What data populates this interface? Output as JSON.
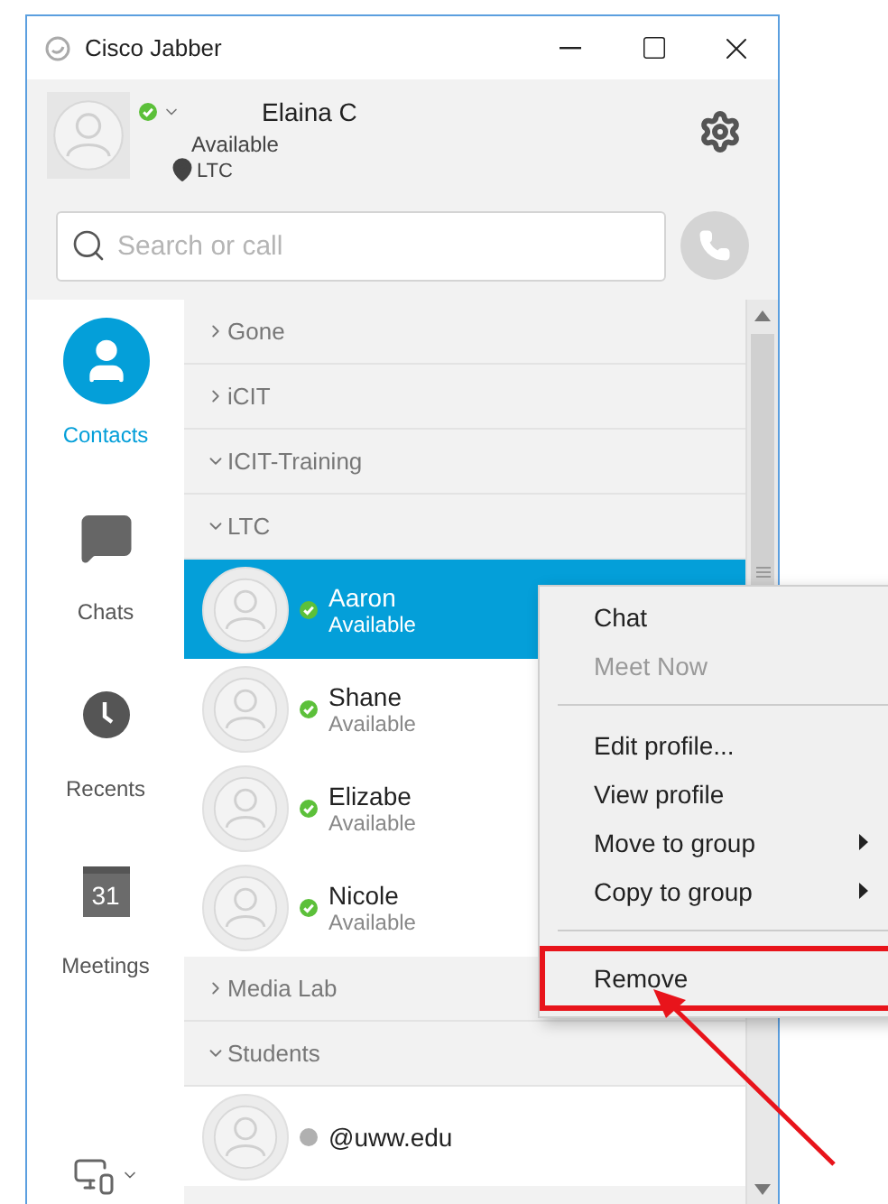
{
  "window": {
    "title": "Cisco Jabber"
  },
  "profile": {
    "name": "Elaina C",
    "online": true,
    "status_text": "Available",
    "location": "LTC"
  },
  "search": {
    "placeholder": "Search or call"
  },
  "nav": [
    {
      "kind": "contacts",
      "label": "Contacts",
      "selected": true
    },
    {
      "kind": "chats",
      "label": "Chats",
      "selected": false
    },
    {
      "kind": "recents",
      "label": "Recents",
      "selected": false
    },
    {
      "kind": "meetings",
      "label": "Meetings",
      "selected": false,
      "badge": "31"
    }
  ],
  "groups": [
    {
      "label": "Gone",
      "expanded": false
    },
    {
      "label": "iCIT",
      "expanded": false
    },
    {
      "label": "ICIT-Training",
      "expanded": true
    },
    {
      "label": "LTC",
      "expanded": true,
      "contacts": [
        {
          "name": "Aaron",
          "online": true,
          "status_text": "Available",
          "selected": true
        },
        {
          "name": "Shane",
          "online": true,
          "status_text": "Available",
          "selected": false
        },
        {
          "name": "Elizabe",
          "online": true,
          "status_text": "Available",
          "selected": false
        },
        {
          "name": "Nicole",
          "online": true,
          "status_text": "Available",
          "selected": false
        }
      ]
    },
    {
      "label": "Media Lab",
      "expanded": false
    },
    {
      "label": "Students",
      "expanded": true,
      "contacts": [
        {
          "name": "@uww.edu",
          "online": false,
          "selected": false
        }
      ]
    }
  ],
  "context_menu": {
    "items": [
      {
        "kind": "item",
        "label": "Chat",
        "disabled": false
      },
      {
        "kind": "item",
        "label": "Meet Now",
        "disabled": true
      },
      {
        "kind": "separator"
      },
      {
        "kind": "item",
        "label": "Edit profile...",
        "disabled": false
      },
      {
        "kind": "item",
        "label": "View profile",
        "disabled": false
      },
      {
        "kind": "submenu",
        "label": "Move to group",
        "disabled": false
      },
      {
        "kind": "submenu",
        "label": "Copy to group",
        "disabled": false
      },
      {
        "kind": "separator"
      },
      {
        "kind": "item",
        "label": "Remove",
        "disabled": false,
        "annotated": true
      }
    ]
  }
}
